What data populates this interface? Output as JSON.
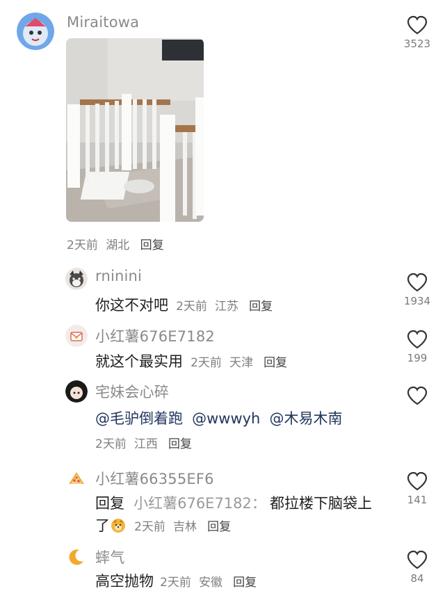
{
  "main_comment": {
    "username": "Miraitowa",
    "meta": {
      "time": "2天前",
      "location": "湖北",
      "reply": "回复"
    },
    "likes": "3523"
  },
  "replies": [
    {
      "username": "rninini",
      "text": "你这不对吧",
      "time": "2天前",
      "location": "江苏",
      "reply": "回复",
      "likes": "1934"
    },
    {
      "username": "小红薯676E7182",
      "text": "就这个最实用",
      "time": "2天前",
      "location": "天津",
      "reply": "回复",
      "likes": "199"
    },
    {
      "username": "宅妹会心碎",
      "mentions": [
        "@毛驴倒着跑",
        "@wwwyh",
        "@木易木南"
      ],
      "time": "2天前",
      "location": "江西",
      "reply": "回复",
      "likes": ""
    },
    {
      "username": "小红薯66355EF6",
      "reply_prefix": "回复",
      "reply_target": "小红薯676E7182",
      "separator": "：",
      "text_line1": "都拉楼下脑袋上",
      "text_line2": "了",
      "time": "2天前",
      "location": "吉林",
      "reply": "回复",
      "likes": "141"
    },
    {
      "username": "蟀气",
      "text": "高空抛物",
      "time": "2天前",
      "location": "安徽",
      "reply": "回复",
      "likes": "84"
    }
  ],
  "icons": {
    "like": "heart-outline-icon",
    "emoji": "doge-emoji-icon"
  },
  "colors": {
    "username": "#8a8a8a",
    "mention": "#21355e",
    "meta": "#7f7f7f"
  }
}
